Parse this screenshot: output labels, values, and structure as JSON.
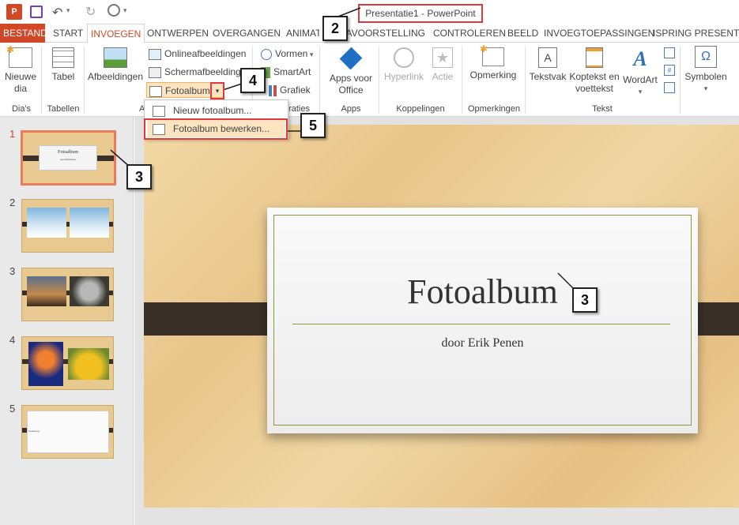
{
  "window": {
    "title": "Presentatie1 - PowerPoint",
    "app_badge": "P"
  },
  "tabs": [
    {
      "label": "BESTAND"
    },
    {
      "label": "START"
    },
    {
      "label": "INVOEGEN"
    },
    {
      "label": "ONTWERPEN"
    },
    {
      "label": "OVERGANGEN"
    },
    {
      "label": "ANIMATIES"
    },
    {
      "label": "DIAVOORSTELLING"
    },
    {
      "label": "CONTROLEREN"
    },
    {
      "label": "BEELD"
    },
    {
      "label": "INVOEGTOEPASSINGEN"
    },
    {
      "label": "ISPRING PRESENTER"
    }
  ],
  "ribbon": {
    "slides": {
      "new_slide": "Nieuwe dia",
      "group": "Dia's"
    },
    "tables": {
      "table": "Tabel",
      "group": "Tabellen"
    },
    "images": {
      "pictures": "Afbeeldingen",
      "online_pictures": "Onlineafbeeldingen",
      "screenshot": "Schermafbeelding",
      "photo_album": "Fotoalbum",
      "group": "Afbeeldingen"
    },
    "illustrations": {
      "shapes": "Vormen",
      "smartart": "SmartArt",
      "chart": "Grafiek",
      "group": "Illustraties"
    },
    "apps": {
      "apps_for_office": "Apps voor Office",
      "group": "Apps"
    },
    "links": {
      "hyperlink": "Hyperlink",
      "action": "Actie",
      "group": "Koppelingen"
    },
    "comments": {
      "comment": "Opmerking",
      "group": "Opmerkingen"
    },
    "text": {
      "textbox": "Tekstvak",
      "header_footer": "Koptekst en voettekst",
      "wordart": "WordArt",
      "group": "Tekst"
    },
    "symbols": {
      "symbols": "Symbolen"
    }
  },
  "dropdown": {
    "items": [
      {
        "label": "Nieuw fotoalbum..."
      },
      {
        "label": "Fotoalbum bewerken..."
      }
    ]
  },
  "slides": [
    {
      "number": "1",
      "title": "Fotoalbum",
      "sub": "door Erik Penen"
    },
    {
      "number": "2"
    },
    {
      "number": "3"
    },
    {
      "number": "4"
    },
    {
      "number": "5",
      "caption": "Koaliejong"
    }
  ],
  "current_slide": {
    "title": "Fotoalbum",
    "subtitle": "door Erik Penen"
  },
  "callouts": {
    "c2": "2",
    "c3a": "3",
    "c3b": "3",
    "c4": "4",
    "c5": "5"
  },
  "colors": {
    "accent": "#d24726",
    "highlight_border": "#e0393e",
    "slide_bg": "#e8c58a",
    "band": "#3b3029"
  }
}
